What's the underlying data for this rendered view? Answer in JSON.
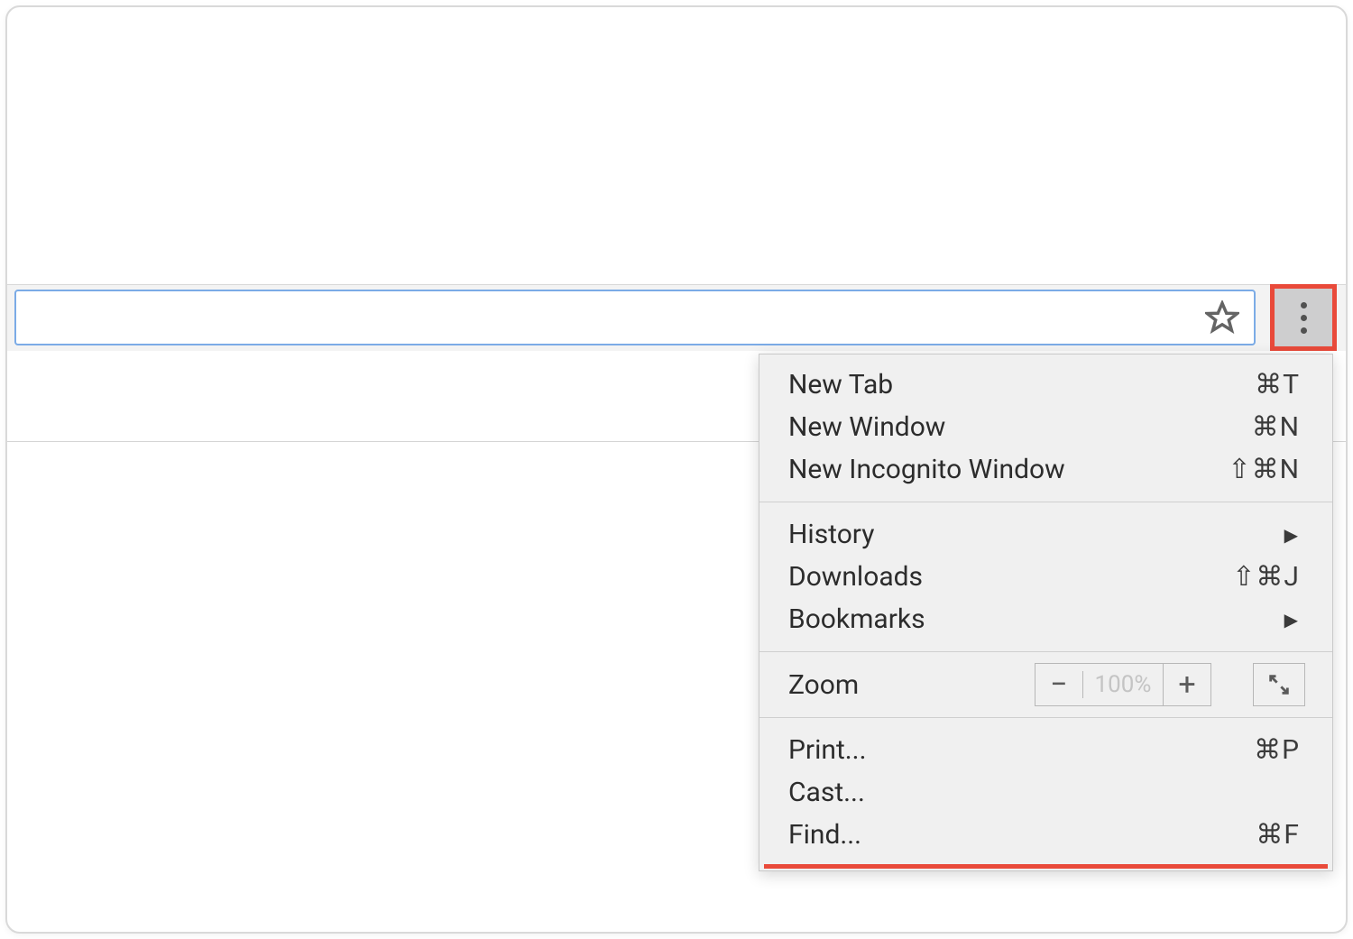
{
  "highlight_color": "#e94a3a",
  "toolbar": {
    "bookmark_star": "star-icon",
    "more_menu": "more-vertical-icon"
  },
  "menu": {
    "groups": [
      {
        "items": [
          {
            "label": "New Tab",
            "shortcut": "⌘T",
            "submenu": false
          },
          {
            "label": "New Window",
            "shortcut": "⌘N",
            "submenu": false
          },
          {
            "label": "New Incognito Window",
            "shortcut": "⇧⌘N",
            "submenu": false
          }
        ]
      },
      {
        "items": [
          {
            "label": "History",
            "shortcut": "",
            "submenu": true
          },
          {
            "label": "Downloads",
            "shortcut": "⇧⌘J",
            "submenu": false
          },
          {
            "label": "Bookmarks",
            "shortcut": "",
            "submenu": true
          }
        ]
      },
      {
        "zoom": {
          "label": "Zoom",
          "value": "100%",
          "minus": "−",
          "plus": "+"
        }
      },
      {
        "items": [
          {
            "label": "Print...",
            "shortcut": "⌘P",
            "submenu": false
          },
          {
            "label": "Cast...",
            "shortcut": "",
            "submenu": false
          },
          {
            "label": "Find...",
            "shortcut": "⌘F",
            "submenu": false
          }
        ]
      }
    ]
  }
}
